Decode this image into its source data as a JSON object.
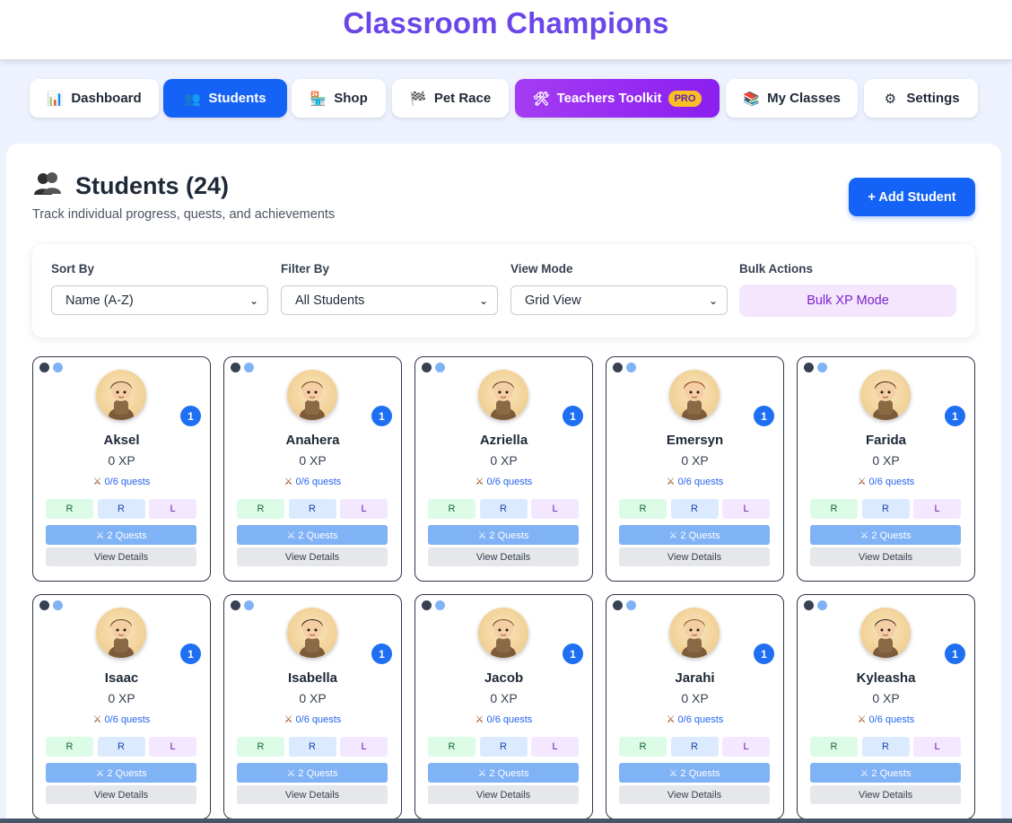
{
  "app": {
    "title": "Classroom Champions"
  },
  "nav": [
    {
      "label": "Dashboard",
      "icon": "bar-chart-icon",
      "glyph": "📊"
    },
    {
      "label": "Students",
      "icon": "students-icon",
      "glyph": "👥",
      "active": true
    },
    {
      "label": "Shop",
      "icon": "shop-icon",
      "glyph": "🏪"
    },
    {
      "label": "Pet Race",
      "icon": "flag-icon",
      "glyph": "🏁"
    },
    {
      "label": "Teachers Toolkit",
      "icon": "tools-icon",
      "glyph": "🛠",
      "badge": "PRO"
    },
    {
      "label": "My Classes",
      "icon": "books-icon",
      "glyph": "📚"
    },
    {
      "label": "Settings",
      "icon": "gear-icon",
      "glyph": "⚙"
    }
  ],
  "page": {
    "title": "Students (24)",
    "title_icon": "students-icon",
    "subtitle": "Track individual progress, quests, and achievements",
    "add_button": "+ Add Student"
  },
  "controls": {
    "sort_label": "Sort By",
    "sort_value": "Name (A-Z)",
    "filter_label": "Filter By",
    "filter_value": "All Students",
    "view_label": "View Mode",
    "view_value": "Grid View",
    "bulk_label": "Bulk Actions",
    "bulk_button": "Bulk XP Mode"
  },
  "card_labels": {
    "r1": "R",
    "r2": "R",
    "l": "L",
    "quests_button": "⚔ 2 Quests",
    "details_button": "View Details"
  },
  "students": [
    {
      "name": "Aksel",
      "xp": "0 XP",
      "quests": "0/6 quests",
      "level": "1"
    },
    {
      "name": "Anahera",
      "xp": "0 XP",
      "quests": "0/6 quests",
      "level": "1"
    },
    {
      "name": "Azriella",
      "xp": "0 XP",
      "quests": "0/6 quests",
      "level": "1"
    },
    {
      "name": "Emersyn",
      "xp": "0 XP",
      "quests": "0/6 quests",
      "level": "1"
    },
    {
      "name": "Farida",
      "xp": "0 XP",
      "quests": "0/6 quests",
      "level": "1"
    },
    {
      "name": "Isaac",
      "xp": "0 XP",
      "quests": "0/6 quests",
      "level": "1"
    },
    {
      "name": "Isabella",
      "xp": "0 XP",
      "quests": "0/6 quests",
      "level": "1"
    },
    {
      "name": "Jacob",
      "xp": "0 XP",
      "quests": "0/6 quests",
      "level": "1"
    },
    {
      "name": "Jarahi",
      "xp": "0 XP",
      "quests": "0/6 quests",
      "level": "1"
    },
    {
      "name": "Kyleasha",
      "xp": "0 XP",
      "quests": "0/6 quests",
      "level": "1"
    }
  ],
  "colors": {
    "brand": "#6b46e8",
    "primary": "#1463f6",
    "toolkit": "#9b2ff2",
    "pro_badge": "#fbbf24",
    "level_badge": "#1e6ff2"
  }
}
